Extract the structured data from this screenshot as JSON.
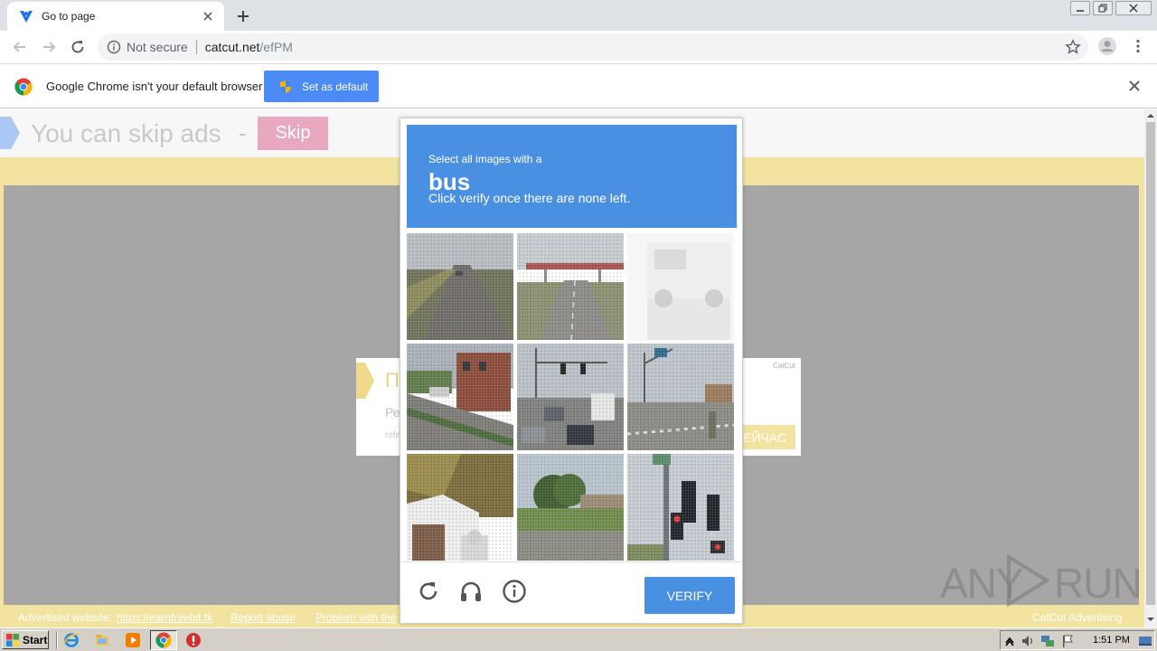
{
  "browser": {
    "tab": {
      "title": "Go to page"
    },
    "address": {
      "security_label": "Not secure",
      "host": "catcut.net",
      "path": "/efPM"
    },
    "infobar": {
      "message": "Google Chrome isn't your default browser",
      "button_label": "Set as default"
    }
  },
  "page": {
    "skip_text": "You can skip ads",
    "skip_dash": "-",
    "skip_button": "Skip",
    "ad_card": {
      "title": "П",
      "line": "Ре",
      "small": "refe",
      "brand": "CatCut",
      "cta": "ЕЙЧАС"
    },
    "footer": {
      "advertised_label": "Advertised website:",
      "advertised_link": "https://earnfreebit.tk",
      "report": "Report abuse",
      "problem": "Problem with the",
      "brand": "CatCut Advertising"
    }
  },
  "captcha": {
    "instruction": "Select all images with a",
    "keyword": "bus",
    "subtext": "Click verify once there are none left.",
    "verify_label": "VERIFY",
    "tiles": [
      {
        "scene": "highway-road"
      },
      {
        "scene": "highway-overpass"
      },
      {
        "scene": "white-vehicle",
        "state": "fading"
      },
      {
        "scene": "street-building"
      },
      {
        "scene": "intersection-traffic"
      },
      {
        "scene": "intersection-signals"
      },
      {
        "scene": "house-garage"
      },
      {
        "scene": "trees-field"
      },
      {
        "scene": "traffic-light-pole"
      }
    ],
    "colors": {
      "header": "#4a90e2",
      "verify": "#4a90e2"
    }
  },
  "watermark": {
    "left": "ANY",
    "right": "RUN"
  },
  "taskbar": {
    "start_label": "Start",
    "clock": "1:51 PM"
  },
  "colors": {
    "chrome_blue": "#4c8bf5",
    "page_yellow": "#f3e3a0",
    "skip_pink": "#e8a9c0"
  }
}
